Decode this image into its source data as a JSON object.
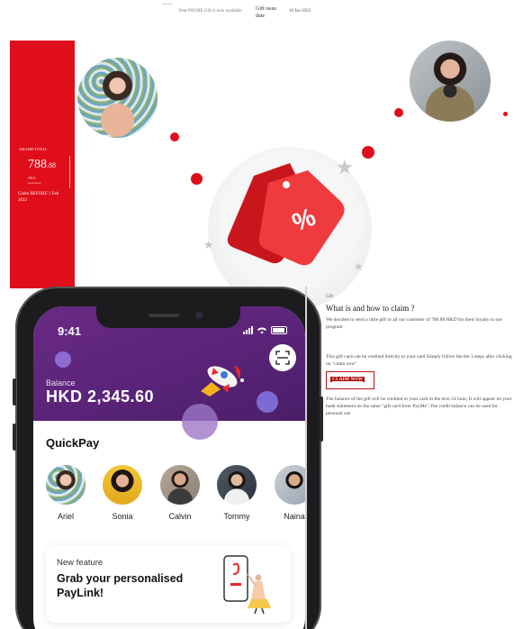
{
  "email_header": {
    "sender_line": "Your PAYME Gift is now available",
    "gift_issue_label": "Gift issue date",
    "gift_issue_date": "10 Jan 2022"
  },
  "card": {
    "grand_total_label": "GRAND TOTAL",
    "amount_main": "788",
    "amount_cents": ".88",
    "currency_sub": "HKD",
    "currency_sub2": "equivalent",
    "claim_before": "Claim BEFORE 1 Feb 2022",
    "color": "#e00d1a"
  },
  "hero": {
    "badge_symbol": "%",
    "accent": "#e8232b"
  },
  "gift_info": {
    "small_label": "Gift",
    "title": "What is and how to claim ?",
    "paragraph1": "We decided to send a little gift to all our customer of 788.88 HKD for their loyalty to our program",
    "paragraph2": "This gift card can be credited directly to your card Simply follow the the 3 steps after clicking on \"claim now\"",
    "claim_button": "CLAIM NOW",
    "paragraph3": "The balance of the gift will be credited to your card in the next 24 hour, It will appear on your bank statement on the same \"gift card from PayMe\".The credit balance can be used for personal use"
  },
  "app": {
    "time": "9:41",
    "balance_label": "Balance",
    "balance_value": "HKD 2,345.60",
    "scan_icon": "scan-icon",
    "header_color": "#5a2478",
    "quickpay_title": "QuickPay",
    "contacts": [
      {
        "name": "Ariel"
      },
      {
        "name": "Sonia"
      },
      {
        "name": "Calvin"
      },
      {
        "name": "Tommy"
      },
      {
        "name": "Naina"
      }
    ],
    "feature": {
      "small": "New feature",
      "big": "Grab your personalised PayLink!"
    }
  }
}
